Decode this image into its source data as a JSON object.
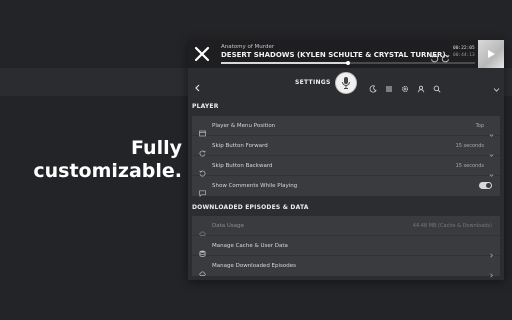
{
  "promo": {
    "line1": "Fully",
    "line2": "customizable."
  },
  "player": {
    "show_name": "Anatomy of Murder",
    "episode_title": "DESERT SHADOWS (KYLEN SCHULTE & CRYSTAL TURNER)",
    "time_current": "00:22:05",
    "time_total": "00:44:13",
    "progress": 0.5
  },
  "header": {
    "title": "SETTINGS"
  },
  "player_section": {
    "title": "PLAYER",
    "rows": [
      {
        "label": "Player & Menu Position",
        "value": "Top",
        "icon": "window-icon"
      },
      {
        "label": "Skip Button Forward",
        "value": "15 seconds",
        "icon": "rotate-cw-icon"
      },
      {
        "label": "Skip Button Backward",
        "value": "15 seconds",
        "icon": "rotate-ccw-icon"
      },
      {
        "label": "Show Comments While Playing",
        "value": "",
        "icon": "comment-icon",
        "toggle": true
      }
    ]
  },
  "data_section": {
    "title": "DOWNLOADED EPISODES & DATA",
    "rows": [
      {
        "label": "Data Usage",
        "value": "44.48 MB (Cache & Downloads)",
        "icon": "cloud-icon"
      },
      {
        "label": "Manage Cache & User Data",
        "icon": "database-icon"
      },
      {
        "label": "Manage Downloaded Episodes",
        "icon": "cloud-download-icon"
      }
    ]
  },
  "colors": {
    "background": "#232427",
    "panel": "#2c2d30",
    "row": "#3a3b3f",
    "player_bar": "#1e1e21"
  }
}
